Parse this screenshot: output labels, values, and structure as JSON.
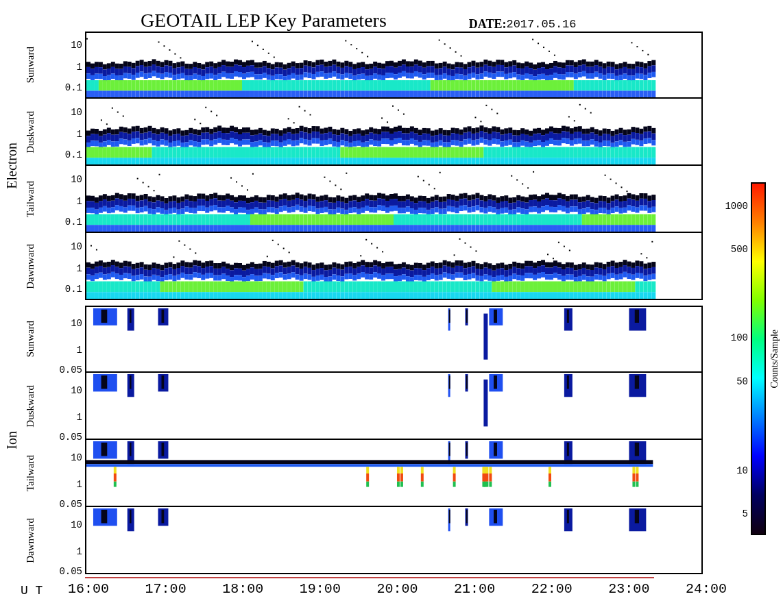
{
  "title": "GEOTAIL LEP Key Parameters",
  "date": {
    "label": "DATE:",
    "value": "2017.05.16"
  },
  "groups": [
    {
      "label": "Electron",
      "kind": "electron",
      "panels": [
        {
          "label": "Sunward",
          "yticks": [
            "10",
            "1",
            "0.1"
          ]
        },
        {
          "label": "Duskward",
          "yticks": [
            "10",
            "1",
            "0.1"
          ]
        },
        {
          "label": "Tailward",
          "yticks": [
            "10",
            "1",
            "0.1"
          ]
        },
        {
          "label": "Dawnward",
          "yticks": [
            "10",
            "1",
            "0.1"
          ]
        }
      ]
    },
    {
      "label": "Ion",
      "kind": "ion",
      "panels": [
        {
          "label": "Sunward",
          "yticks": [
            "10",
            "1",
            "0.05"
          ]
        },
        {
          "label": "Duskward",
          "yticks": [
            "10",
            "1",
            "0.05"
          ]
        },
        {
          "label": "Tailward",
          "yticks": [
            "10",
            "1",
            "0.05"
          ]
        },
        {
          "label": "Dawnward",
          "yticks": [
            "10",
            "1",
            "0.05"
          ]
        }
      ]
    }
  ],
  "time_axis": {
    "label": "U T",
    "ticks": [
      "16:00",
      "17:00",
      "18:00",
      "19:00",
      "20:00",
      "21:00",
      "22:00",
      "23:00",
      "24:00"
    ]
  },
  "colorbar": {
    "title": "Counts/Sample",
    "ticks": [
      "1000",
      "500",
      "100",
      "50",
      "10",
      "5"
    ]
  }
}
